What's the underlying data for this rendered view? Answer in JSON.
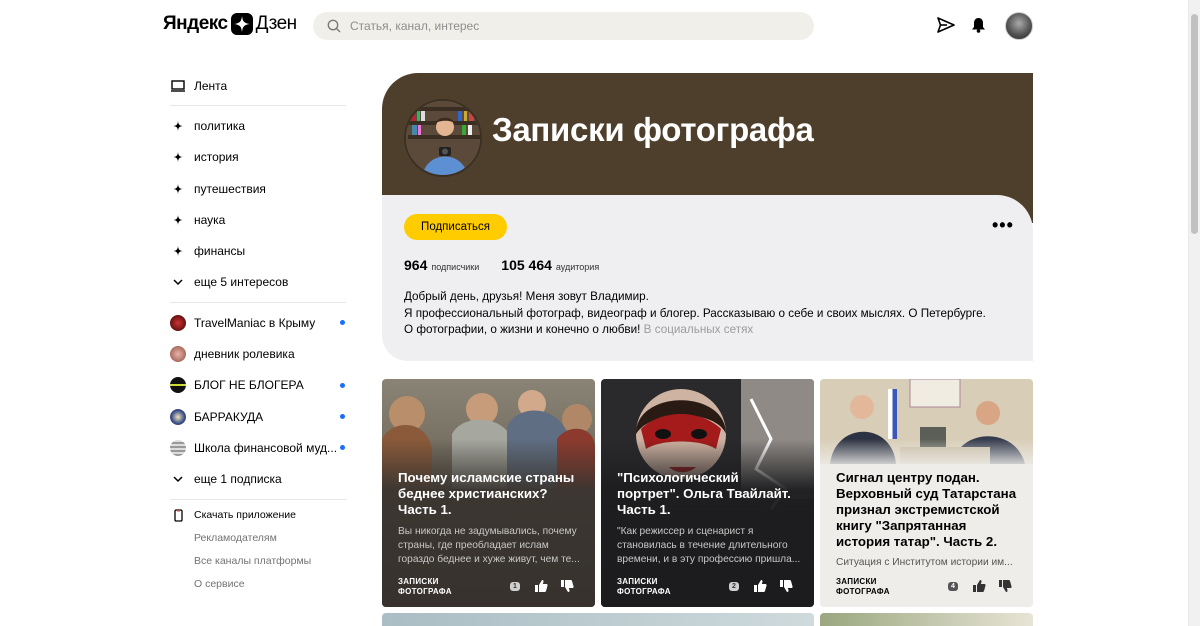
{
  "header": {
    "logo_left": "Яндекс",
    "logo_right": "Дзен",
    "search_placeholder": "Статья, канал, интерес",
    "icons": [
      "search-icon",
      "send-icon",
      "bell-icon",
      "avatar"
    ]
  },
  "sidebar": {
    "feed": "Лента",
    "interests": [
      "политика",
      "история",
      "путешествия",
      "наука",
      "финансы"
    ],
    "more_interests": "еще 5 интересов",
    "subscriptions": [
      {
        "name": "TravelManiac в Крыму",
        "unread": true
      },
      {
        "name": "дневник ролевика",
        "unread": false
      },
      {
        "name": "БЛОГ НЕ БЛОГЕРА",
        "unread": true
      },
      {
        "name": "БАРРАКУДА",
        "unread": true
      },
      {
        "name": "Школа финансовой муд...",
        "unread": true
      }
    ],
    "more_subs": "еще 1 подписка",
    "footer": [
      "Скачать приложение",
      "Рекламодателям",
      "Все каналы платформы",
      "О сервисе"
    ]
  },
  "channel": {
    "title": "Записки фотографа",
    "subscribe": "Подписаться",
    "more": "•••",
    "subscribers_value": "964",
    "subscribers_label": "подписчики",
    "audience_value": "105 464",
    "audience_label": "аудитория",
    "bio_1": "Добрый день, друзья! Меня зовут Владимир.",
    "bio_2": "Я профессиональный фотограф, видеограф и блогер. Рассказываю о себе и своих мыслях. О Петербурге.",
    "bio_3": "О фотографии, о жизни и конечно о любви!",
    "social": "В социальных сетях",
    "colors": {
      "header_bg": "#4e3f2d",
      "info_bg": "#efeff1",
      "button": "#ffcc00"
    }
  },
  "cards": [
    {
      "title": "Почему исламские страны беднее христианских? Часть 1.",
      "snippet": "Вы никогда не задумывались, почему страны, где преобладает ислам гораздо беднее и хуже живут, чем те...",
      "source_1": "ЗАПИСКИ",
      "source_2": "ФОТОГРАФА",
      "comments": "1"
    },
    {
      "title": "\"Психологический портрет\". Ольга Твайлайт. Часть 1.",
      "snippet": "\"Как режиссер и сценарист я становилась в течение длительного времени, и в эту профессию пришла...",
      "source_1": "ЗАПИСКИ",
      "source_2": "ФОТОГРАФА",
      "comments": "2"
    },
    {
      "title": "Сигнал центру подан. Верховный суд Татарстана признал экстремистской книгу \"Запрятанная история татар\". Часть 2.",
      "snippet": "Ситуация с Институтом истории им...",
      "source_1": "ЗАПИСКИ",
      "source_2": "ФОТОГРАФА",
      "comments": "4"
    }
  ]
}
